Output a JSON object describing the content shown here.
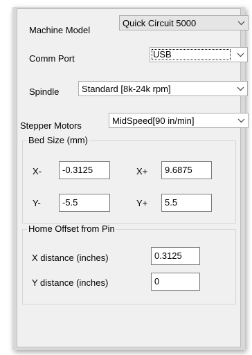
{
  "settings": {
    "machine_model": {
      "label": "Machine Model",
      "value": "Quick Circuit 5000"
    },
    "comm_port": {
      "label": "Comm Port",
      "value": "USB"
    },
    "spindle": {
      "label": "Spindle",
      "value": "Standard [8k-24k rpm]"
    },
    "stepper_motors": {
      "label": "Stepper Motors",
      "value": "MidSpeed[90 in/min]"
    }
  },
  "bed_size": {
    "title": "Bed Size (mm)",
    "x_minus": {
      "label": "X-",
      "value": "-0.3125"
    },
    "x_plus": {
      "label": "X+",
      "value": "9.6875"
    },
    "y_minus": {
      "label": "Y-",
      "value": "-5.5"
    },
    "y_plus": {
      "label": "Y+",
      "value": "5.5"
    }
  },
  "home_offset": {
    "title": "Home Offset from Pin",
    "x_distance": {
      "label": "X distance (inches)",
      "value": "0.3125"
    },
    "y_distance": {
      "label": "Y distance (inches)",
      "value": "0"
    }
  },
  "icons": {
    "dropdown": "chevron-down-icon"
  }
}
